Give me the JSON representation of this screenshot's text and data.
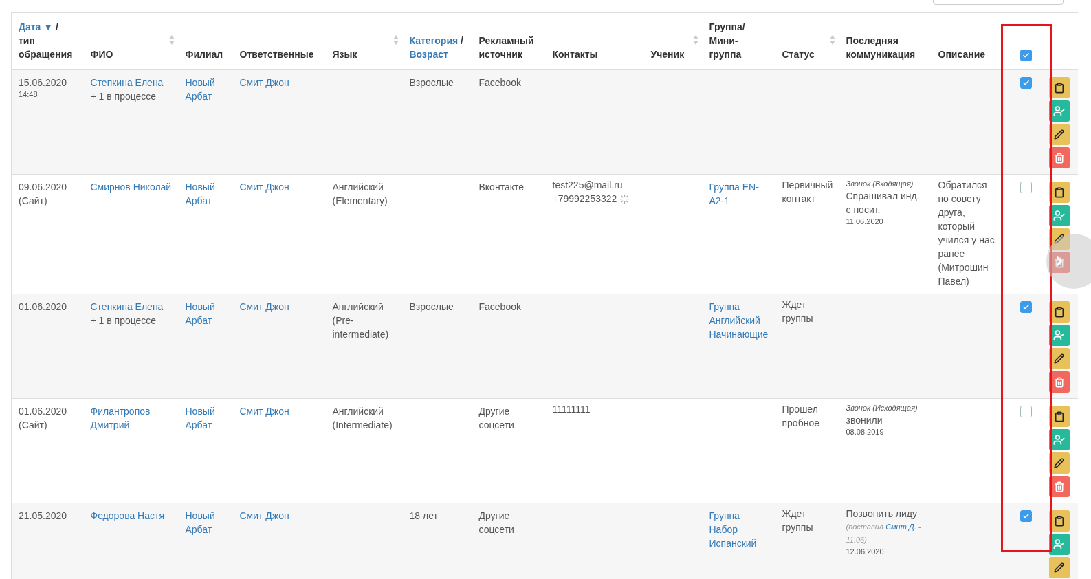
{
  "table": {
    "columns": [
      {
        "parts": [
          {
            "text": "Дата ▼",
            "link": true
          },
          {
            "text": "/",
            "link": false
          },
          {
            "text": "тип обращения",
            "link": false
          }
        ],
        "sortable": false
      },
      {
        "parts": [
          {
            "text": "ФИО",
            "link": false
          }
        ],
        "sortable": true
      },
      {
        "parts": [
          {
            "text": "Филиал",
            "link": false
          }
        ],
        "sortable": false
      },
      {
        "parts": [
          {
            "text": "Ответственные",
            "link": false
          }
        ],
        "sortable": false
      },
      {
        "parts": [
          {
            "text": "Язык",
            "link": false
          }
        ],
        "sortable": true
      },
      {
        "parts": [
          {
            "text": "Категория",
            "link": true
          },
          {
            "text": "/",
            "link": false
          },
          {
            "text": "Возраст",
            "link": true
          }
        ],
        "sortable": false
      },
      {
        "parts": [
          {
            "text": "Рекламный источник",
            "link": false
          }
        ],
        "sortable": false
      },
      {
        "parts": [
          {
            "text": "Контакты",
            "link": false
          }
        ],
        "sortable": false
      },
      {
        "parts": [
          {
            "text": "Ученик",
            "link": false
          }
        ],
        "sortable": true
      },
      {
        "parts": [
          {
            "text": "Группа/ Мини-группа",
            "link": false
          }
        ],
        "sortable": false
      },
      {
        "parts": [
          {
            "text": "Статус",
            "link": false
          }
        ],
        "sortable": true
      },
      {
        "parts": [
          {
            "text": "Последняя коммуникация",
            "link": false
          }
        ],
        "sortable": false
      },
      {
        "parts": [
          {
            "text": "Описание",
            "link": false
          }
        ],
        "sortable": false
      }
    ],
    "select_all": {
      "checked": true
    },
    "rows": [
      {
        "date": "15.06.2020",
        "time": "14:48",
        "name": "Степкина Елена",
        "name_extra": "+ 1 в процессе",
        "branch": "Новый Арбат",
        "responsible": "Смит Джон",
        "category": "Взрослые",
        "source": "Facebook",
        "checked": true
      },
      {
        "date": "09.06.2020",
        "type": "(Сайт)",
        "name": "Смирнов Николай",
        "branch": "Новый Арбат",
        "responsible": "Смит Джон",
        "language": "Английский (Elementary)",
        "source": "Вконтакте",
        "contacts": [
          "test225@mail.ru",
          "+79992253322"
        ],
        "contacts_loading": true,
        "group": "Группа EN-A2-1",
        "status": "Первичный контакт",
        "communication": {
          "kind": "Звонок (Входящая)",
          "text": "Спрашивал инд. с носит.",
          "date": "11.06.2020"
        },
        "description": "Обратился по совету друга, который учился у нас ранее (Митрошин Павел)",
        "checked": false
      },
      {
        "date": "01.06.2020",
        "name": "Степкина Елена",
        "name_extra": "+ 1 в процессе",
        "branch": "Новый Арбат",
        "responsible": "Смит Джон",
        "language": "Английский (Pre-intermediate)",
        "category": "Взрослые",
        "source": "Facebook",
        "group": "Группа Английский Начинающие",
        "status": "Ждет группы",
        "checked": true
      },
      {
        "date": "01.06.2020",
        "type": "(Сайт)",
        "name": "Филантропов Дмитрий",
        "branch": "Новый Арбат",
        "responsible": "Смит Джон",
        "language": "Английский (Intermediate)",
        "source": "Другие соцсети",
        "contacts": [
          "11111111"
        ],
        "status": "Прошел пробное",
        "communication": {
          "kind": "Звонок (Исходящая)",
          "text": "звонили",
          "date": "08.08.2019"
        },
        "checked": false
      },
      {
        "date": "21.05.2020",
        "name": "Федорова Настя",
        "branch": "Новый Арбат",
        "responsible": "Смит Джон",
        "category": "18 лет",
        "source": "Другие соцсети",
        "group": "Группа Набор Испанский",
        "status": "Ждет группы",
        "communication": {
          "text": "Позвонить лиду",
          "note_before": "(поставил ",
          "note_link": "Смит Д.",
          "note_after": " - 11.06)",
          "date": "12.06.2020"
        },
        "checked": true
      }
    ]
  }
}
